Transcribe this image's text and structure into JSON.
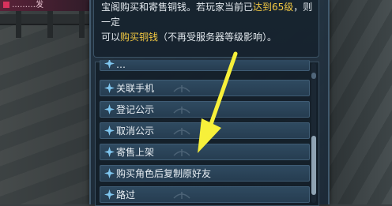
{
  "window": {
    "top_badge": "………发"
  },
  "description": {
    "line1": "宝阁购买和寄售铜钱。若玩家当前已",
    "line1_highlight": "达到65级",
    "line1_tail": "，则一定",
    "line2_head": "可以",
    "line2_highlight": "购买铜钱",
    "line2_tail": "（不再受服务器等级影响）。"
  },
  "menu": {
    "items": [
      {
        "label": "…"
      },
      {
        "label": "关联手机"
      },
      {
        "label": "登记公示"
      },
      {
        "label": "取消公示"
      },
      {
        "label": "寄售上架"
      },
      {
        "label": "购买角色后复制原好友"
      },
      {
        "label": "路过"
      }
    ]
  },
  "colors": {
    "highlight": "#f2c842",
    "arrow": "#f7f03a"
  },
  "icons": {
    "item_icon": "sparkle-icon",
    "arrow_annotation": "yellow-arrow"
  }
}
